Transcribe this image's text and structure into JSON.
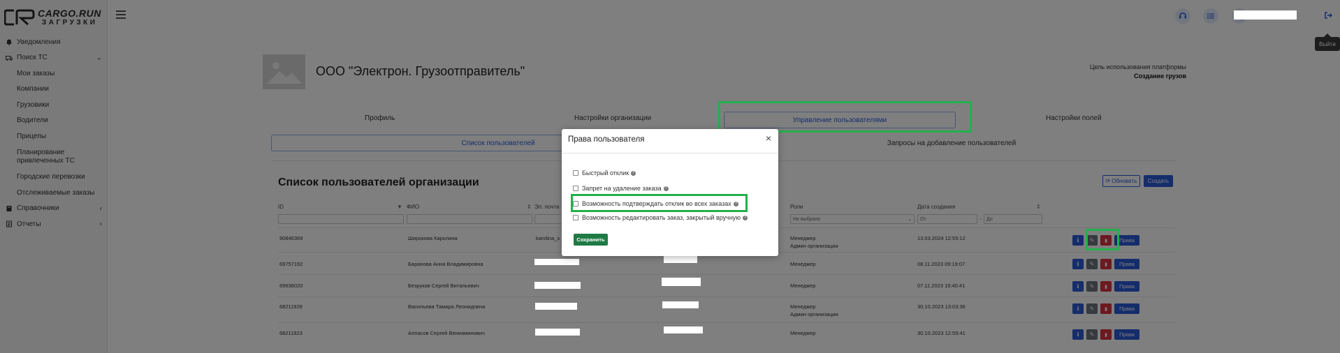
{
  "logo": {
    "line1": "CARGO.RUN",
    "line2": "ЗАГРУЗКИ"
  },
  "sidebar": {
    "items": [
      {
        "label": "Уведомления",
        "icon": "bell-icon",
        "level": 0
      },
      {
        "label": "Поиск ТС",
        "icon": "truck-icon",
        "level": 0,
        "chevron": "⌄"
      },
      {
        "label": "Мои заказы",
        "level": 1
      },
      {
        "label": "Компании",
        "level": 1
      },
      {
        "label": "Грузовики",
        "level": 1
      },
      {
        "label": "Водители",
        "level": 1
      },
      {
        "label": "Прицепы",
        "level": 1
      },
      {
        "label": "Планирование привлеченных ТС",
        "level": 1
      },
      {
        "label": "Городские перевозки",
        "level": 1
      },
      {
        "label": "Отслеживаемые заказы",
        "level": 1
      },
      {
        "label": "Справочники",
        "icon": "book-icon",
        "level": 0,
        "chevron": "‹"
      },
      {
        "label": "Отчеты",
        "icon": "report-icon",
        "level": 0,
        "chevron": "‹"
      }
    ]
  },
  "header": {
    "logout_tooltip": "Выйти"
  },
  "org": {
    "name": "ООО \"Электрон. Грузоотправитель\"",
    "purpose_label": "Цель использования платформы",
    "purpose_value": "Создание грузов"
  },
  "tabs": [
    {
      "label": "Профиль"
    },
    {
      "label": "Настройки организации"
    },
    {
      "label": "Управление пользователями"
    },
    {
      "label": "Настройки полей"
    }
  ],
  "subtabs": [
    {
      "label": "Список пользователей"
    },
    {
      "label": "Запросы на добавление пользователей"
    }
  ],
  "list": {
    "title": "Список пользователей организации",
    "refresh_label": "Обновить",
    "create_label": "Создать",
    "columns": [
      "ID",
      "ФИО",
      "Эл. почта",
      "",
      "Роли",
      "Дата создания"
    ],
    "filters": {
      "role_select": "Не выбрано",
      "date_from": "От",
      "date_to": "До",
      "date_sep": "-"
    },
    "rows": [
      {
        "id": "90846369",
        "name": "Широкова Каролина",
        "email": "karolina_s",
        "roles": [
          "Менеджер",
          "Админ организации"
        ],
        "created": "13.03.2024 12:55:12"
      },
      {
        "id": "69757192",
        "name": "Баранова Анна Владимировна",
        "email": "",
        "roles": [
          "Менеджер"
        ],
        "created": "08.11.2023 09:19:07"
      },
      {
        "id": "69636020",
        "name": "Безруков Сергей Витальевич",
        "email": "",
        "roles": [
          "Менеджер"
        ],
        "created": "07.11.2023 15:40:41"
      },
      {
        "id": "68211928",
        "name": "Васильева Тамара Леонидовна",
        "email": "",
        "roles": [
          "Менеджер",
          "Админ организации"
        ],
        "created": "30.10.2023 13:03:36"
      },
      {
        "id": "68211923",
        "name": "Алпасов Сергей Вениаминович",
        "email": "",
        "roles": [
          "Менеджер"
        ],
        "created": "30.10.2023 12:59:41"
      }
    ],
    "rights_label": "Права"
  },
  "modal": {
    "title": "Права пользователя",
    "close": "×",
    "options": [
      {
        "label": "Быстрый отклик",
        "checked": false
      },
      {
        "label": "Запрет на удаление заказа",
        "checked": false
      },
      {
        "label": "Возможность подтверждать отклик во всех заказах",
        "checked": false
      },
      {
        "label": "Возможность редактировать заказ, закрытый вручную",
        "checked": false
      }
    ],
    "save_label": "Сохранить"
  },
  "colors": {
    "primary": "#2a5bd7",
    "highlight": "#22b04b",
    "danger": "#d9333f",
    "save": "#1f7a45"
  }
}
